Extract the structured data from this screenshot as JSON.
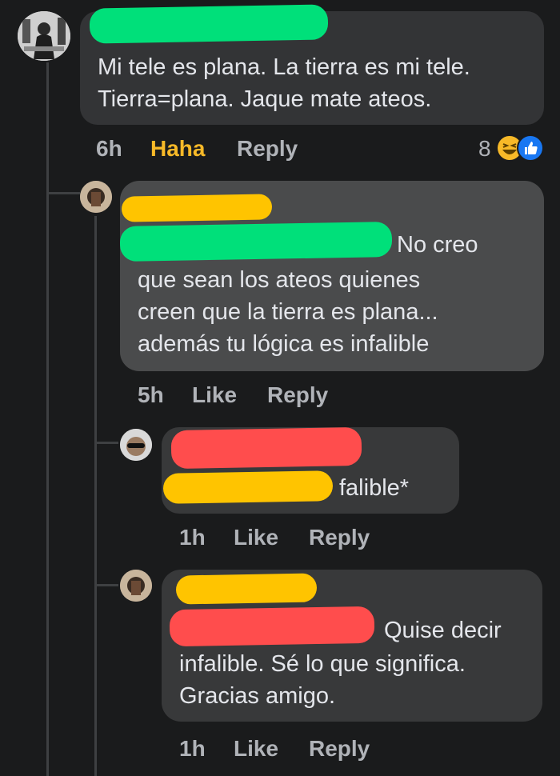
{
  "thread": {
    "comments": [
      {
        "text_lines": [
          "Mi tele es plana. La tierra es mi tele.",
          "Tierra=plana. Jaque mate ateos."
        ],
        "time": "6h",
        "reaction_action": "Haha",
        "reply": "Reply",
        "reaction_count": "8",
        "reaction_icons": [
          "haha-emoji-icon",
          "like-thumb-icon"
        ]
      },
      {
        "text_lines": [
          "No creo",
          "que sean los ateos quienes",
          "creen que la tierra es plana...",
          "además tu lógica es infalible"
        ],
        "time": "5h",
        "like": "Like",
        "reply": "Reply"
      },
      {
        "text_lines": [
          "falible*"
        ],
        "time": "1h",
        "like": "Like",
        "reply": "Reply"
      },
      {
        "text_lines": [
          "Quise decir",
          "infalible. Sé lo que significa.",
          "Gracias amigo."
        ],
        "time": "1h",
        "like": "Like",
        "reply": "Reply"
      }
    ]
  },
  "colors": {
    "background": "#1a1b1c",
    "bubble": "#3a3b3c",
    "text": "#e4e6eb",
    "meta": "#b0b3b8",
    "haha_accent": "#f7b928",
    "redact_green": "#00e07a",
    "redact_yellow": "#ffc400",
    "redact_red": "#ff4d4d"
  }
}
